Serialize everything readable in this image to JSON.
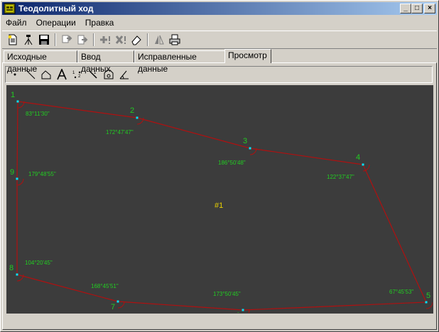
{
  "app": {
    "title": "Теодолитный ход"
  },
  "window_buttons": {
    "minimize": "_",
    "maximize": "□",
    "close": "×"
  },
  "menu": [
    {
      "id": "file",
      "label": "Файл"
    },
    {
      "id": "operations",
      "label": "Операции"
    },
    {
      "id": "edit",
      "label": "Правка"
    }
  ],
  "toolbar": {
    "buttons": [
      "new-document-icon",
      "theodolite-icon",
      "save-icon",
      "copy-icon",
      "paste-icon",
      "add-point-icon",
      "delete-point-icon",
      "eraser-icon",
      "mirror-icon",
      "print-icon"
    ]
  },
  "tabs": [
    {
      "id": "source",
      "label": "Исходные данные"
    },
    {
      "id": "input",
      "label": "Ввод данных"
    },
    {
      "id": "corrected",
      "label": "Исправленные данные"
    },
    {
      "id": "view",
      "label": "Просмотр",
      "active": true
    }
  ],
  "draw_tools": [
    "point-tool-icon",
    "line-tool-icon",
    "polygon-tool-icon",
    "text-tool-icon",
    "point-numbers-icon",
    "lines-numbers-icon",
    "area-tool-icon",
    "angle-tool-icon"
  ],
  "canvas": {
    "background": "#3c3c3c",
    "line_color": "#b01010",
    "label_color": "#22cc22",
    "vertex_color": "#00e5ff",
    "center_label": "#1",
    "center_label_color": "#e8d000",
    "vertices": [
      {
        "id": "1",
        "angle": "83°11'30\""
      },
      {
        "id": "2",
        "angle": "172°47'47\""
      },
      {
        "id": "3",
        "angle": "186°50'48\""
      },
      {
        "id": "4",
        "angle": "122°37'47\""
      },
      {
        "id": "5",
        "angle": "67°45'53\""
      },
      {
        "id": "6",
        "angle": "173°50'45\""
      },
      {
        "id": "7",
        "angle": "168°45'51\""
      },
      {
        "id": "8",
        "angle": "104°20'45\""
      },
      {
        "id": "9",
        "angle": "179°48'55\""
      }
    ]
  }
}
